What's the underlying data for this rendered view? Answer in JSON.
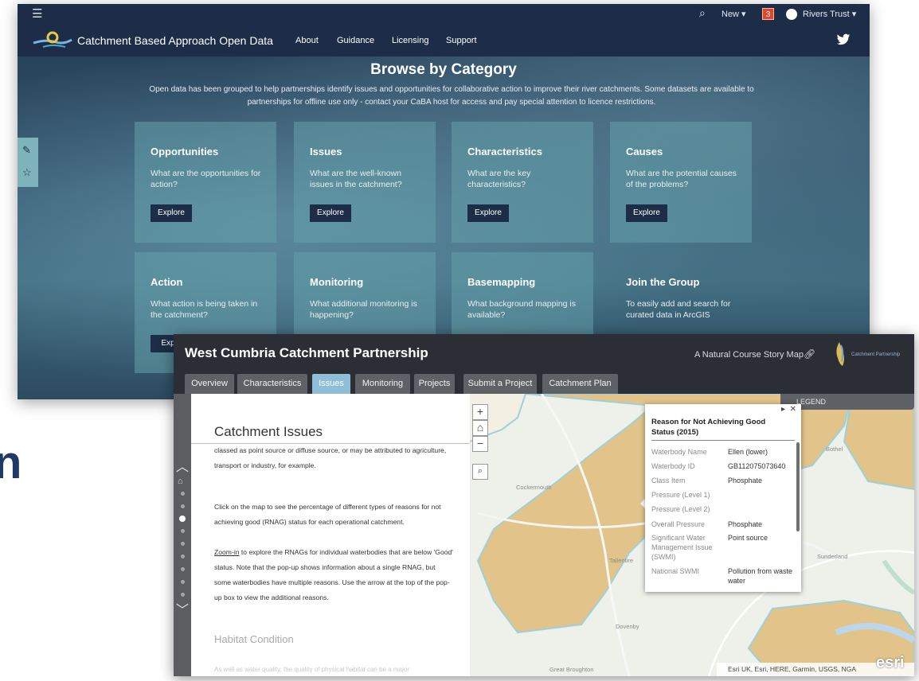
{
  "caba": {
    "top_bar": {
      "new_label": "New ▾",
      "notification_count": "3",
      "user_label": "Rivers Trust ▾"
    },
    "nav": {
      "site_title": "Catchment Based Approach Open Data",
      "links": [
        "About",
        "Guidance",
        "Licensing",
        "Support"
      ]
    },
    "heading": "Browse by Category",
    "intro": "Open data has been grouped to help partnerships identify issues and opportunities for collaborative action to improve their river catchments. Some datasets are available to partnerships for offline use only - contact your CaBA host for access and pay special attention to licence restrictions.",
    "tiles": [
      {
        "title": "Opportunities",
        "desc": "What are the opportunities for action?",
        "button": "Explore"
      },
      {
        "title": "Issues",
        "desc": "What are the well-known issues in the catchment?",
        "button": "Explore"
      },
      {
        "title": "Characteristics",
        "desc": "What are the key characteristics?",
        "button": "Explore"
      },
      {
        "title": "Causes",
        "desc": "What are the potential causes of the problems?",
        "button": "Explore"
      },
      {
        "title": "Action",
        "desc": "What action is being taken in the catchment?",
        "button": "Explo"
      },
      {
        "title": "Monitoring",
        "desc": "What additional monitoring is happening?"
      },
      {
        "title": "Basemapping",
        "desc": "What background mapping is available?"
      },
      {
        "title": "Join the Group",
        "desc": "To easily add and search for curated data in ArcGIS"
      }
    ],
    "colors": {
      "nav": "#1d2d47",
      "tile": "#64a0aa",
      "button": "#1d2d47"
    }
  },
  "stray_letter": "n",
  "west_cumbria": {
    "title": "West Cumbria Catchment Partnership",
    "subtitle": "A Natural Course Story Map",
    "logo_text": "Catchment Partnership",
    "tabs": [
      {
        "label": "Overview",
        "active": false
      },
      {
        "label": "Characteristics",
        "active": false
      },
      {
        "label": "Issues",
        "active": true
      },
      {
        "label": "Monitoring",
        "active": false
      },
      {
        "label": "Projects",
        "active": false
      },
      {
        "label": "Submit a Project",
        "active": false
      },
      {
        "label": "Catchment Plan",
        "active": false
      }
    ],
    "panel": {
      "heading": "Catchment Issues",
      "p1": "classed as point source or diffuse source, or may be attributed to agriculture, transport or industry, for example.",
      "p2": "Click on the map to see the percentage of different types of reasons for not achieving good (RNAG) status for each operational catchment.",
      "p3_link": "Zoom-in",
      "p3_rest": " to explore the RNAGs for individual waterbodies that are below 'Good' status. Note that the pop-up shows information about a single RNAG, but some waterbodies have multiple reasons. Use the arrow at the top of the pop-up box to view the additional reasons.",
      "h2": "Habitat Condition",
      "fade_text": "As well as water quality, the quality of physical habitat can be a major"
    },
    "map": {
      "legend_label": "LEGEND",
      "attribution": "Esri UK, Esri, HERE, Garmin, USGS, NGA",
      "esri_logo": "esri",
      "controls": {
        "zoom_in": "+",
        "zoom_out": "−"
      },
      "places": [
        "Cockermouth",
        "Dovenby",
        "Great Broughton",
        "Sunderland",
        "Bothel",
        "Tallentire"
      ],
      "colors": {
        "area": "#e2c48a",
        "area_border": "#9fd0d6"
      }
    },
    "popup": {
      "title": "Reason for Not Achieving Good Status (2015)",
      "rows": [
        {
          "label": "Waterbody Name",
          "value": "Ellen (lower)"
        },
        {
          "label": "Waterbody ID",
          "value": "GB112075073640"
        },
        {
          "label": "Class Item",
          "value": "Phosphate"
        },
        {
          "label": "Pressure (Level 1)",
          "value": ""
        },
        {
          "label": "Pressure (Level 2)",
          "value": ""
        },
        {
          "label": "Overall Pressure",
          "value": "Phosphate"
        },
        {
          "label": "Significant Water Management Issue (SWMI)",
          "value": "Point source"
        },
        {
          "label": "National SWMI",
          "value": "Pollution from waste water"
        }
      ]
    }
  }
}
